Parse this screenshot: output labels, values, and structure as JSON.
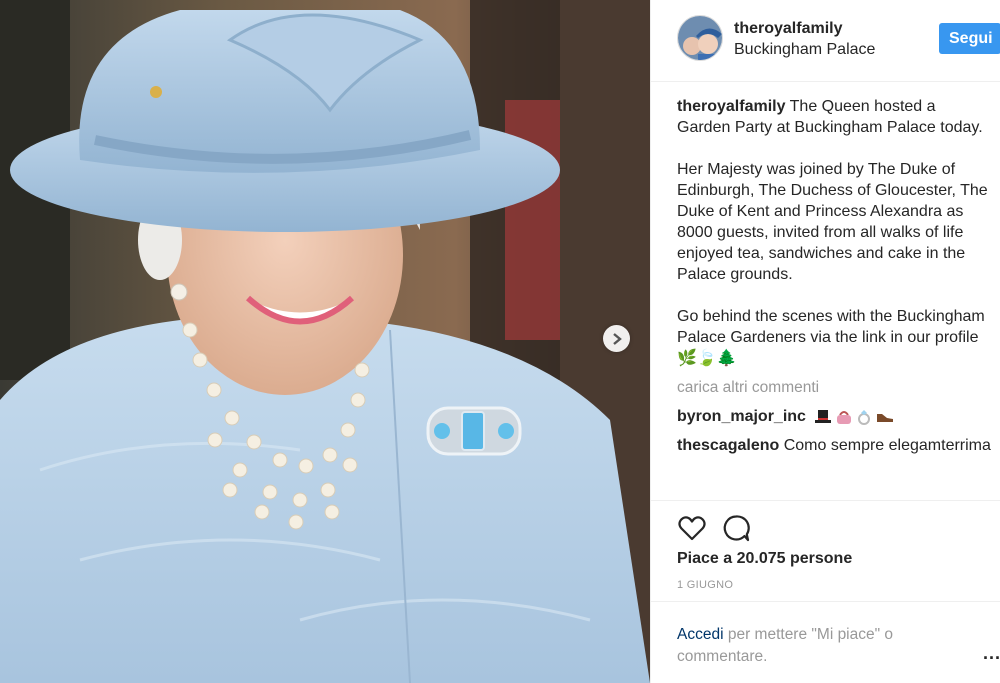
{
  "header": {
    "username": "theroyalfamily",
    "location": "Buckingham Palace",
    "follow_label": "Segui"
  },
  "caption": {
    "username": "theroyalfamily",
    "paragraph1": "The Queen hosted a Garden Party at Buckingham Palace today.",
    "paragraph2": "Her Majesty was joined by The Duke of Edinburgh, The Duchess of Gloucester, The Duke of Kent and Princess Alexandra as 8000 guests, invited from all walks of life enjoyed tea, sandwiches and cake in the Palace grounds.",
    "paragraph3": "Go behind the scenes with the Buckingham Palace Gardeners via the link in our profile 🌿🍃🌲"
  },
  "load_more": "carica altri commenti",
  "comments": [
    {
      "username": "byron_major_inc",
      "text": ""
    },
    {
      "username": "thescagaleno",
      "text": "Como sempre elegamterrima"
    }
  ],
  "likes_text": "Piace a 20.075 persone",
  "date": "1 GIUGNO",
  "login": {
    "link": "Accedi",
    "rest": " per mettere \"Mi piace\" o commentare.",
    "more_dots": "..."
  },
  "icons": {
    "heart": "heart-icon",
    "comment": "comment-icon",
    "next": "chevron-right-icon"
  },
  "colors": {
    "accent": "#3897f0",
    "link": "#003569",
    "muted": "#999999",
    "hat": "#a9c7e0",
    "dress": "#b8d3e8"
  }
}
